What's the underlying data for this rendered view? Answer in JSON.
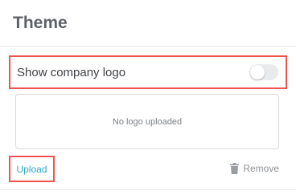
{
  "section": {
    "title": "Theme"
  },
  "company_logo": {
    "toggle_label": "Show company logo",
    "toggle_on": false,
    "placeholder": "No logo uploaded",
    "upload_label": "Upload",
    "remove_label": "Remove",
    "remove_icon": "trash-icon"
  },
  "colors": {
    "highlight": "#ef5350",
    "link": "#2aa8c6",
    "toggle_track": "#e8eaec"
  }
}
